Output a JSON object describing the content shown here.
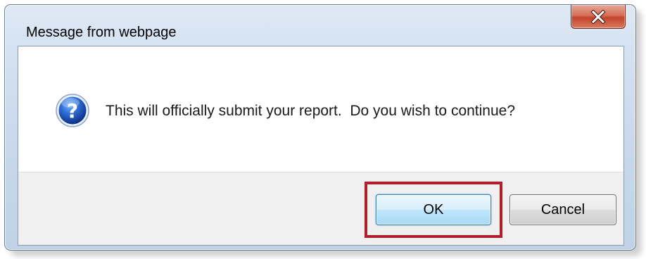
{
  "window": {
    "title": "Message from webpage",
    "close_icon": "close-icon"
  },
  "dialog": {
    "icon": "question-icon",
    "message": "This will officially submit your report.  Do you wish to continue?"
  },
  "buttons": {
    "ok_label": "OK",
    "cancel_label": "Cancel"
  },
  "colors": {
    "highlight": "#b01f2c",
    "close_button": "#c4432a",
    "ok_focus": "#3c7fb1"
  }
}
